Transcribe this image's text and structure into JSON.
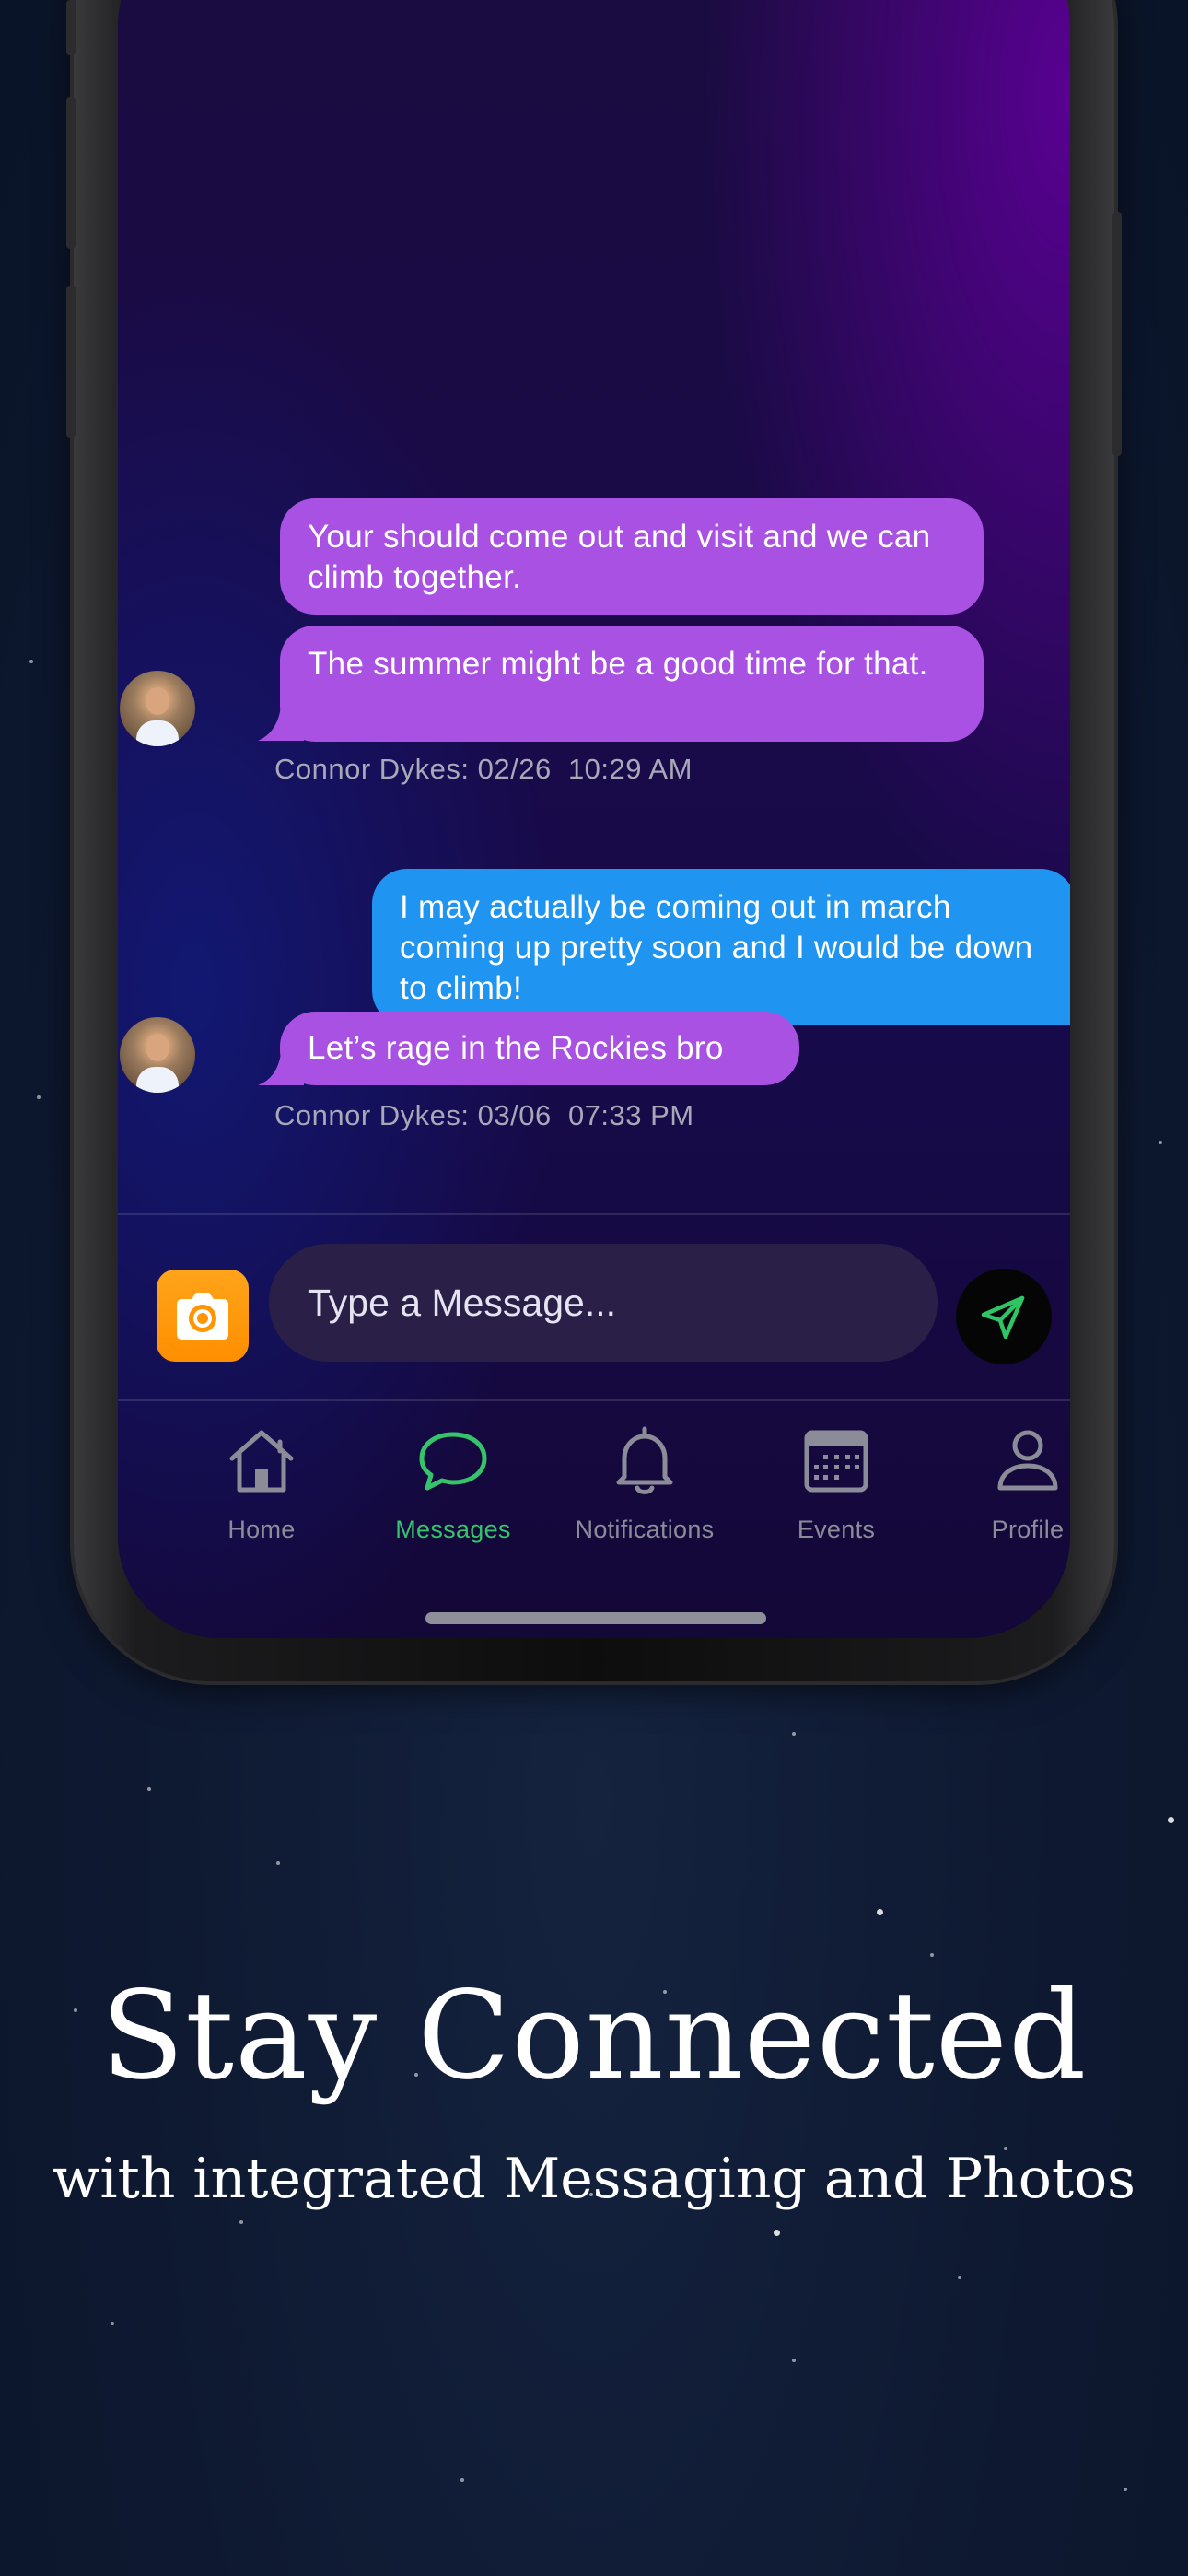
{
  "colors": {
    "incoming_bubble": "#a951e2",
    "outgoing_bubble": "#1f94f0",
    "active_tab": "#35c46a",
    "camera_button": "#ff9500"
  },
  "chat": {
    "messages": [
      {
        "sender": "other",
        "text": "Your should come out and visit and we can climb together."
      },
      {
        "sender": "other",
        "text": "The summer might be a good time for that."
      },
      {
        "sender": "me",
        "text": "I may actually be coming out in march coming up pretty soon and I would be down to climb!"
      },
      {
        "sender": "other",
        "text": "Let’s rage in the Rockies bro"
      }
    ],
    "timestamps": [
      "Connor Dykes: 02/26  10:29 AM",
      "Connor Dykes: 03/06  07:33 PM"
    ]
  },
  "composer": {
    "placeholder": "Type a Message...",
    "camera_icon": "camera-icon",
    "send_icon": "send-icon"
  },
  "tabbar": {
    "items": [
      {
        "label": "Home",
        "icon": "home-icon",
        "active": false
      },
      {
        "label": "Messages",
        "icon": "chat-bubble-icon",
        "active": true
      },
      {
        "label": "Notifications",
        "icon": "bell-icon",
        "active": false
      },
      {
        "label": "Events",
        "icon": "calendar-icon",
        "active": false
      },
      {
        "label": "Profile",
        "icon": "person-icon",
        "active": false
      }
    ]
  },
  "promo": {
    "title": "Stay Connected",
    "subtitle": "with integrated Messaging and Photos"
  }
}
